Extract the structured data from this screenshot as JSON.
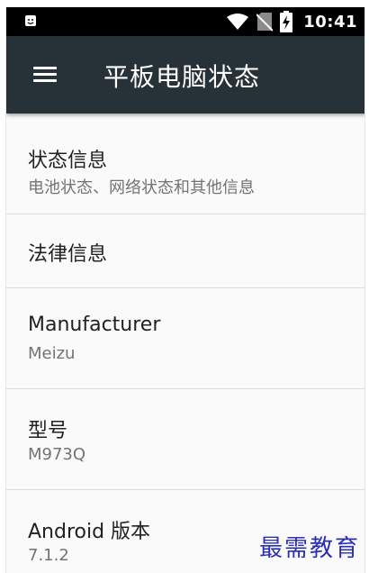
{
  "status_bar": {
    "time": "10:41",
    "icons": [
      "android-notification-icon",
      "wifi-icon",
      "no-sim-icon",
      "battery-charging-icon"
    ]
  },
  "app_bar": {
    "title": "平板电脑状态",
    "menu_icon": "menu-icon"
  },
  "items": [
    {
      "title": "状态信息",
      "summary": "电池状态、网络状态和其他信息"
    },
    {
      "title": "法律信息"
    },
    {
      "title": "Manufacturer",
      "summary": "Meizu"
    },
    {
      "title": "型号",
      "summary": "M973Q"
    },
    {
      "title": "Android 版本",
      "summary": "7.1.2"
    }
  ],
  "watermark": "最需教育",
  "colors": {
    "status_bar": "#000000",
    "app_bar": "#263238",
    "background": "#fafafa",
    "title_text": "#212121",
    "summary_text": "#737373",
    "watermark": "#2b2fb5"
  }
}
